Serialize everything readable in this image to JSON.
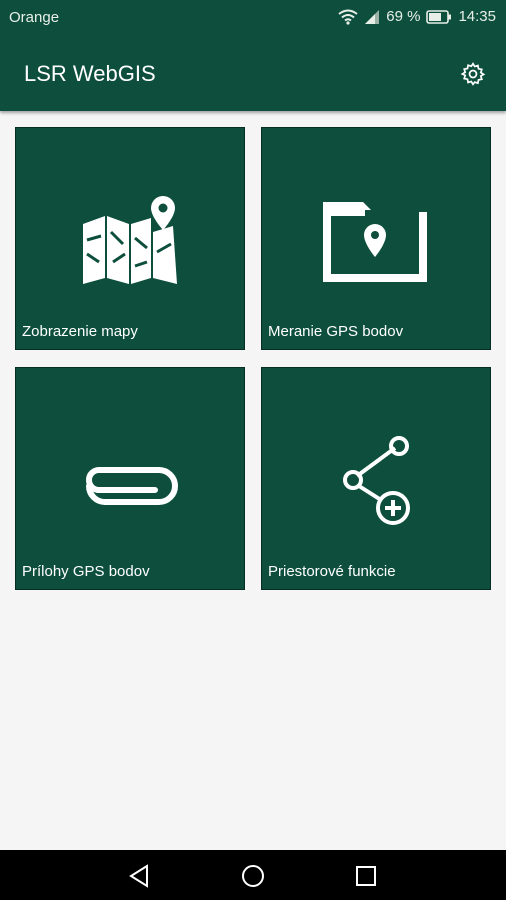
{
  "status_bar": {
    "carrier": "Orange",
    "battery_percent": "69 %",
    "time": "14:35",
    "icons": [
      "wifi-icon",
      "signal-icon",
      "battery-icon"
    ]
  },
  "app_bar": {
    "title": "LSR WebGIS",
    "settings_icon": "gear-icon"
  },
  "tiles": [
    {
      "label": "Zobrazenie mapy",
      "icon": "map-pin-icon"
    },
    {
      "label": "Meranie GPS bodov",
      "icon": "folder-pin-icon"
    },
    {
      "label": "Prílohy GPS bodov",
      "icon": "paperclip-icon"
    },
    {
      "label": "Priestorové funkcie",
      "icon": "share-add-icon"
    }
  ],
  "nav_bar": {
    "icons": [
      "back-icon",
      "home-icon",
      "recents-icon"
    ]
  },
  "colors": {
    "primary": "#0d4f3c",
    "background": "#f5f5f5",
    "navbar": "#000000"
  }
}
